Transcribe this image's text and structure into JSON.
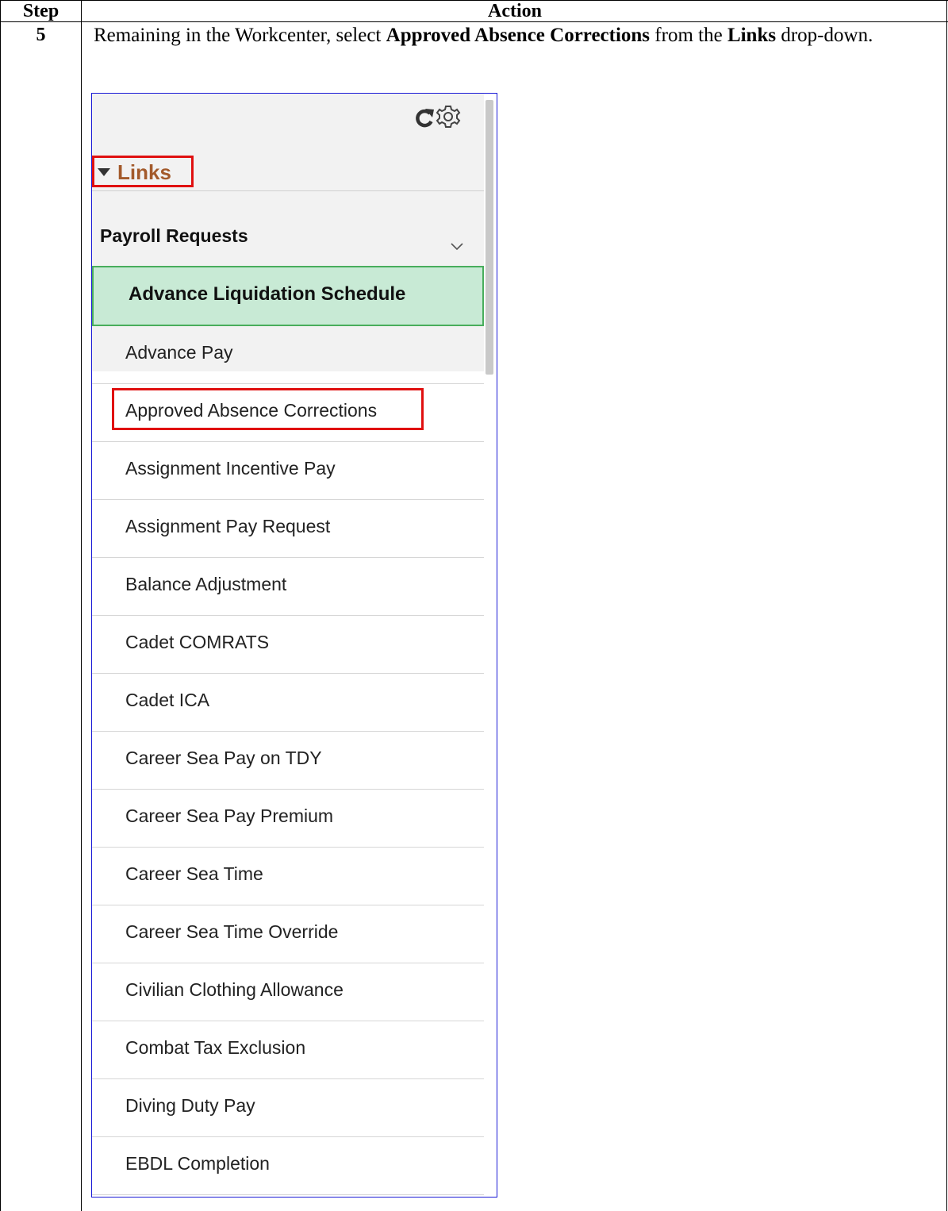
{
  "table": {
    "step_header": "Step",
    "action_header": "Action",
    "step_number": "5",
    "instruction": {
      "part1": "Remaining in the Workcenter, select ",
      "bold1": "Approved Absence Corrections",
      "part2": " from the ",
      "bold2": "Links",
      "part3": " drop-down."
    }
  },
  "panel": {
    "toolbar_icons": [
      "refresh-icon",
      "gear-icon"
    ],
    "links_label": "Links",
    "group_title": "Payroll Requests",
    "selected_item": "Advance Liquidation Schedule",
    "items": [
      "Advance Pay",
      "Approved Absence Corrections",
      "Assignment Incentive Pay",
      "Assignment Pay Request",
      "Balance Adjustment",
      "Cadet COMRATS",
      "Cadet ICA",
      "Career Sea Pay on TDY",
      "Career Sea Pay Premium",
      "Career Sea Time",
      "Career Sea Time Override",
      "Civilian Clothing Allowance",
      "Combat Tax Exclusion",
      "Diving Duty Pay",
      "EBDL Completion"
    ],
    "colors": {
      "links_label": "#a35a2b",
      "selected_bg": "#c8ead5",
      "selected_border": "#48ad5c",
      "callout": "#e01010",
      "panel_border": "#1a1ad6"
    }
  }
}
